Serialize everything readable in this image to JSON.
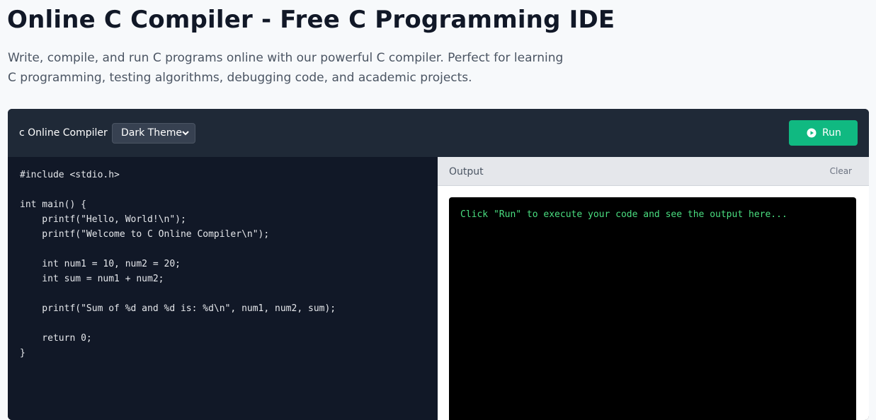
{
  "page": {
    "title": "Online C Compiler - Free C Programming IDE",
    "description": "Write, compile, and run C programs online with our powerful C compiler. Perfect for learning C programming, testing algorithms, debugging code, and academic projects."
  },
  "toolbar": {
    "compiler_label": "c Online Compiler",
    "theme_selected": "Dark Theme",
    "theme_chevron_icon": "chevron-down-icon",
    "run_label": "Run",
    "run_icon": "play-circle-icon",
    "run_color": "#10b981"
  },
  "editor": {
    "lines": [
      "#include <stdio.h>",
      "",
      "int main() {",
      "    printf(\"Hello, World!\\n\");",
      "    printf(\"Welcome to C Online Compiler\\n\");",
      "",
      "    int num1 = 10, num2 = 20;",
      "    int sum = num1 + num2;",
      "",
      "    printf(\"Sum of %d and %d is: %d\\n\", num1, num2, sum);",
      "",
      "    return 0;",
      "}"
    ]
  },
  "output": {
    "title": "Output",
    "clear_label": "Clear",
    "placeholder": "Click \"Run\" to execute your code and see the output here...",
    "text_color": "#4ade80"
  }
}
